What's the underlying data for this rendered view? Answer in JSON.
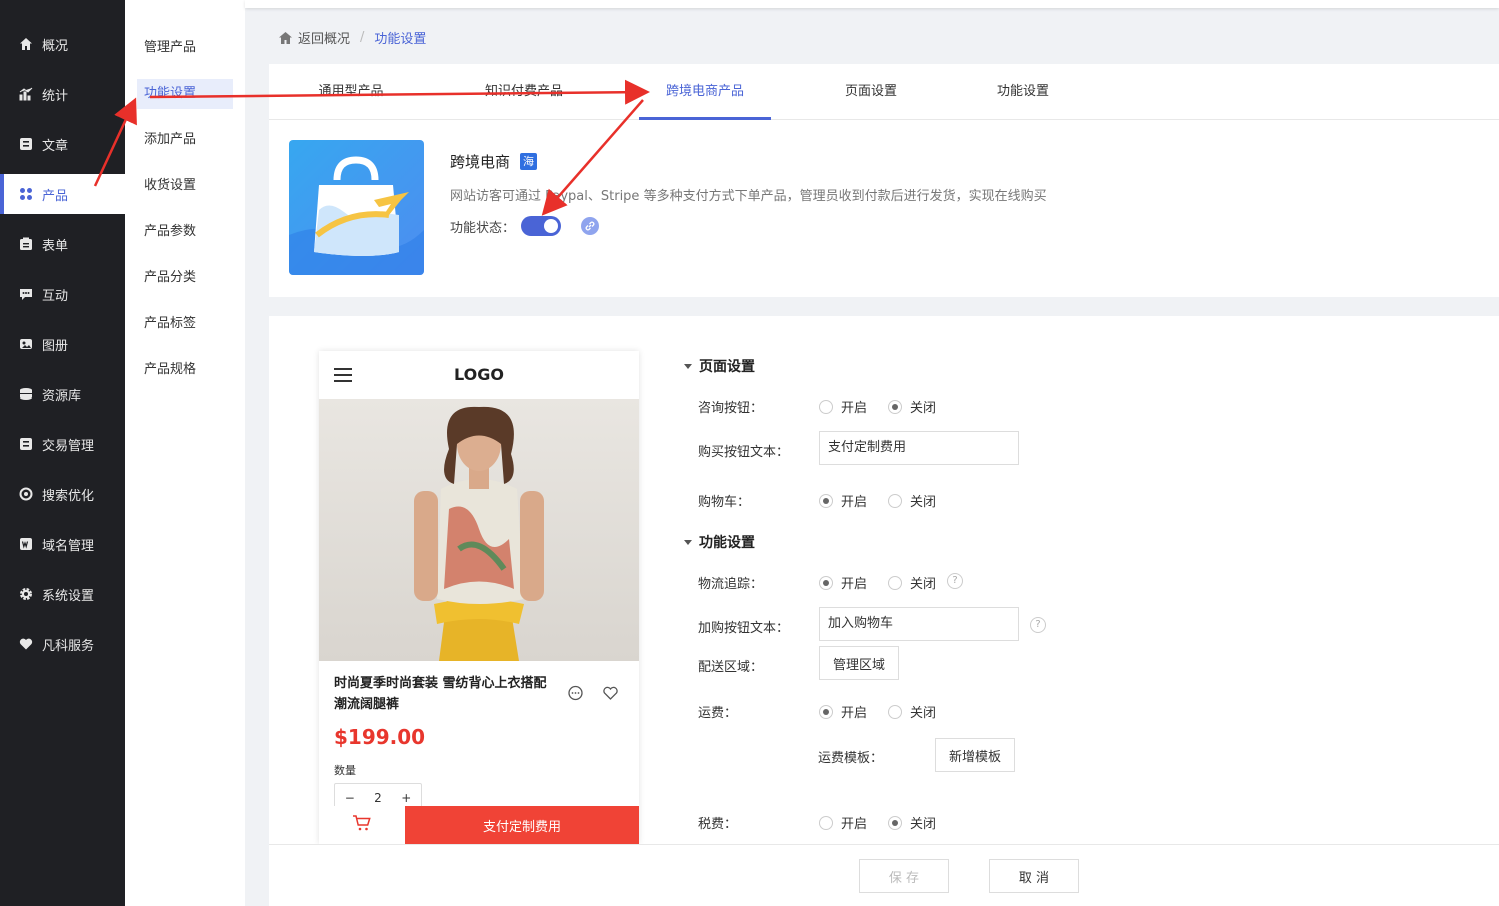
{
  "sidebar": {
    "items": [
      {
        "label": "概况",
        "icon": "home-icon"
      },
      {
        "label": "统计",
        "icon": "chart-icon"
      },
      {
        "label": "文章",
        "icon": "article-icon"
      },
      {
        "label": "产品",
        "icon": "grid-icon"
      },
      {
        "label": "表单",
        "icon": "form-icon"
      },
      {
        "label": "互动",
        "icon": "chat-icon"
      },
      {
        "label": "图册",
        "icon": "album-icon"
      },
      {
        "label": "资源库",
        "icon": "database-icon"
      },
      {
        "label": "交易管理",
        "icon": "trade-icon"
      },
      {
        "label": "搜索优化",
        "icon": "seo-icon"
      },
      {
        "label": "域名管理",
        "icon": "domain-icon"
      },
      {
        "label": "系统设置",
        "icon": "gear-icon"
      },
      {
        "label": "凡科服务",
        "icon": "heart-icon"
      }
    ]
  },
  "subnav": {
    "items": [
      "管理产品",
      "功能设置",
      "添加产品",
      "收货设置",
      "产品参数",
      "产品分类",
      "产品标签",
      "产品规格"
    ]
  },
  "breadcrumb": {
    "back": "返回概况",
    "sep": "/",
    "current": "功能设置"
  },
  "tabs": [
    "通用型产品",
    "知识付费产品",
    "跨境电商产品",
    "页面设置",
    "功能设置"
  ],
  "feature": {
    "title": "跨境电商",
    "badge": "海",
    "desc": "网站访客可通过 Paypal、Stripe 等多种支付方式下单产品，管理员收到付款后进行发货，实现在线购买",
    "status_label": "功能状态：",
    "status_on": true
  },
  "preview": {
    "logo": "LOGO",
    "title": "时尚夏季时尚套装 雪纺背心上衣搭配潮流阔腿裤",
    "price": "$199.00",
    "qty_label": "数量",
    "qty_minus": "−",
    "qty_value": "2",
    "qty_plus": "+",
    "pay_button": "支付定制费用"
  },
  "page_settings": {
    "heading": "页面设置",
    "consult_label": "咨询按钮：",
    "buy_text_label": "购买按钮文本：",
    "buy_text_value": "支付定制费用",
    "cart_label": "购物车："
  },
  "func_settings": {
    "heading": "功能设置",
    "track_label": "物流追踪：",
    "add_text_label": "加购按钮文本：",
    "add_text_value": "加入购物车",
    "region_label": "配送区域：",
    "region_button": "管理区域",
    "freight_label": "运费：",
    "template_label": "运费模板：",
    "template_button": "新增模板",
    "tax_label": "税费："
  },
  "radio": {
    "on": "开启",
    "off": "关闭",
    "help": "?"
  },
  "footer": {
    "save": "保 存",
    "cancel": "取 消"
  },
  "colors": {
    "accent": "#4a64d6",
    "price": "#e8362d",
    "pay": "#f04336",
    "arrow": "#e8302a"
  }
}
